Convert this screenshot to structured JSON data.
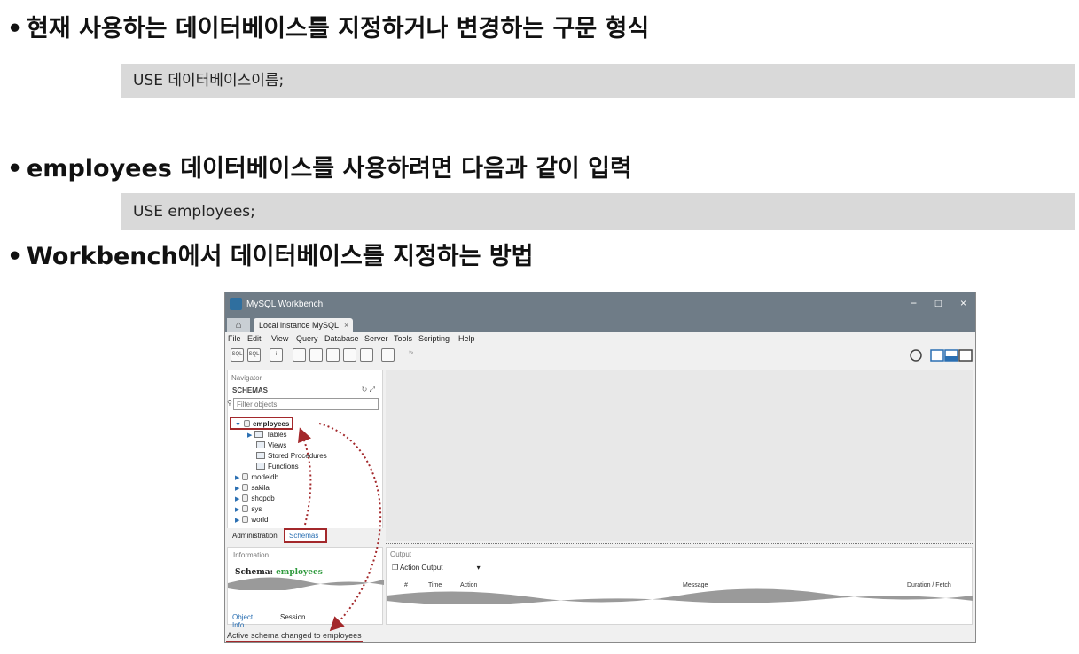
{
  "slide": {
    "bullet_marker": "•",
    "bullets": [
      "현재 사용하는 데이터베이스를 지정하거나 변경하는 구문 형식",
      "employees 데이터베이스를 사용하려면 다음과 같이 입력",
      "Workbench에서 데이터베이스를 지정하는 방법"
    ],
    "code": [
      "USE 데이터베이스이름;",
      "USE employees;"
    ]
  },
  "workbench": {
    "window_title": "MySQL Workbench",
    "window_controls": {
      "minimize": "−",
      "maximize": "□",
      "close": "×"
    },
    "home_icon": "⌂",
    "connection_tab": "Local instance MySQL",
    "tab_close": "×",
    "menu": [
      "File",
      "Edit",
      "View",
      "Query",
      "Database",
      "Server",
      "Tools",
      "Scripting",
      "Help"
    ],
    "toolbar_icons": [
      "new-sql-tab-icon",
      "open-sql-file-icon",
      "inspector-icon",
      "create-schema-icon",
      "create-table-icon",
      "create-view-icon",
      "create-procedure-icon",
      "create-function-icon",
      "search-table-data-icon",
      "reconnect-icon"
    ],
    "navigator": {
      "header": "Navigator",
      "schemas_label": "SCHEMAS",
      "filter_placeholder": "Filter objects",
      "active_schema": "employees",
      "children": [
        "Tables",
        "Views",
        "Stored Procedures",
        "Functions"
      ],
      "other_schemas": [
        "modeldb",
        "sakila",
        "shopdb",
        "sys",
        "world"
      ],
      "tabs": [
        "Administration",
        "Schemas"
      ]
    },
    "information": {
      "header": "Information",
      "schema_prefix": "Schema:",
      "schema_name": "employees",
      "tabs": [
        "Object Info",
        "Session"
      ]
    },
    "output": {
      "header": "Output",
      "selector": "Action Output",
      "columns": [
        "#",
        "Time",
        "Action",
        "Message",
        "Duration / Fetch"
      ]
    },
    "status_bar": "Active schema changed to employees",
    "colors": {
      "highlight": "#a3282b",
      "schema_green": "#2e9a3c",
      "link_blue": "#2a6fb2",
      "titlebar": "#6f7c87"
    }
  }
}
